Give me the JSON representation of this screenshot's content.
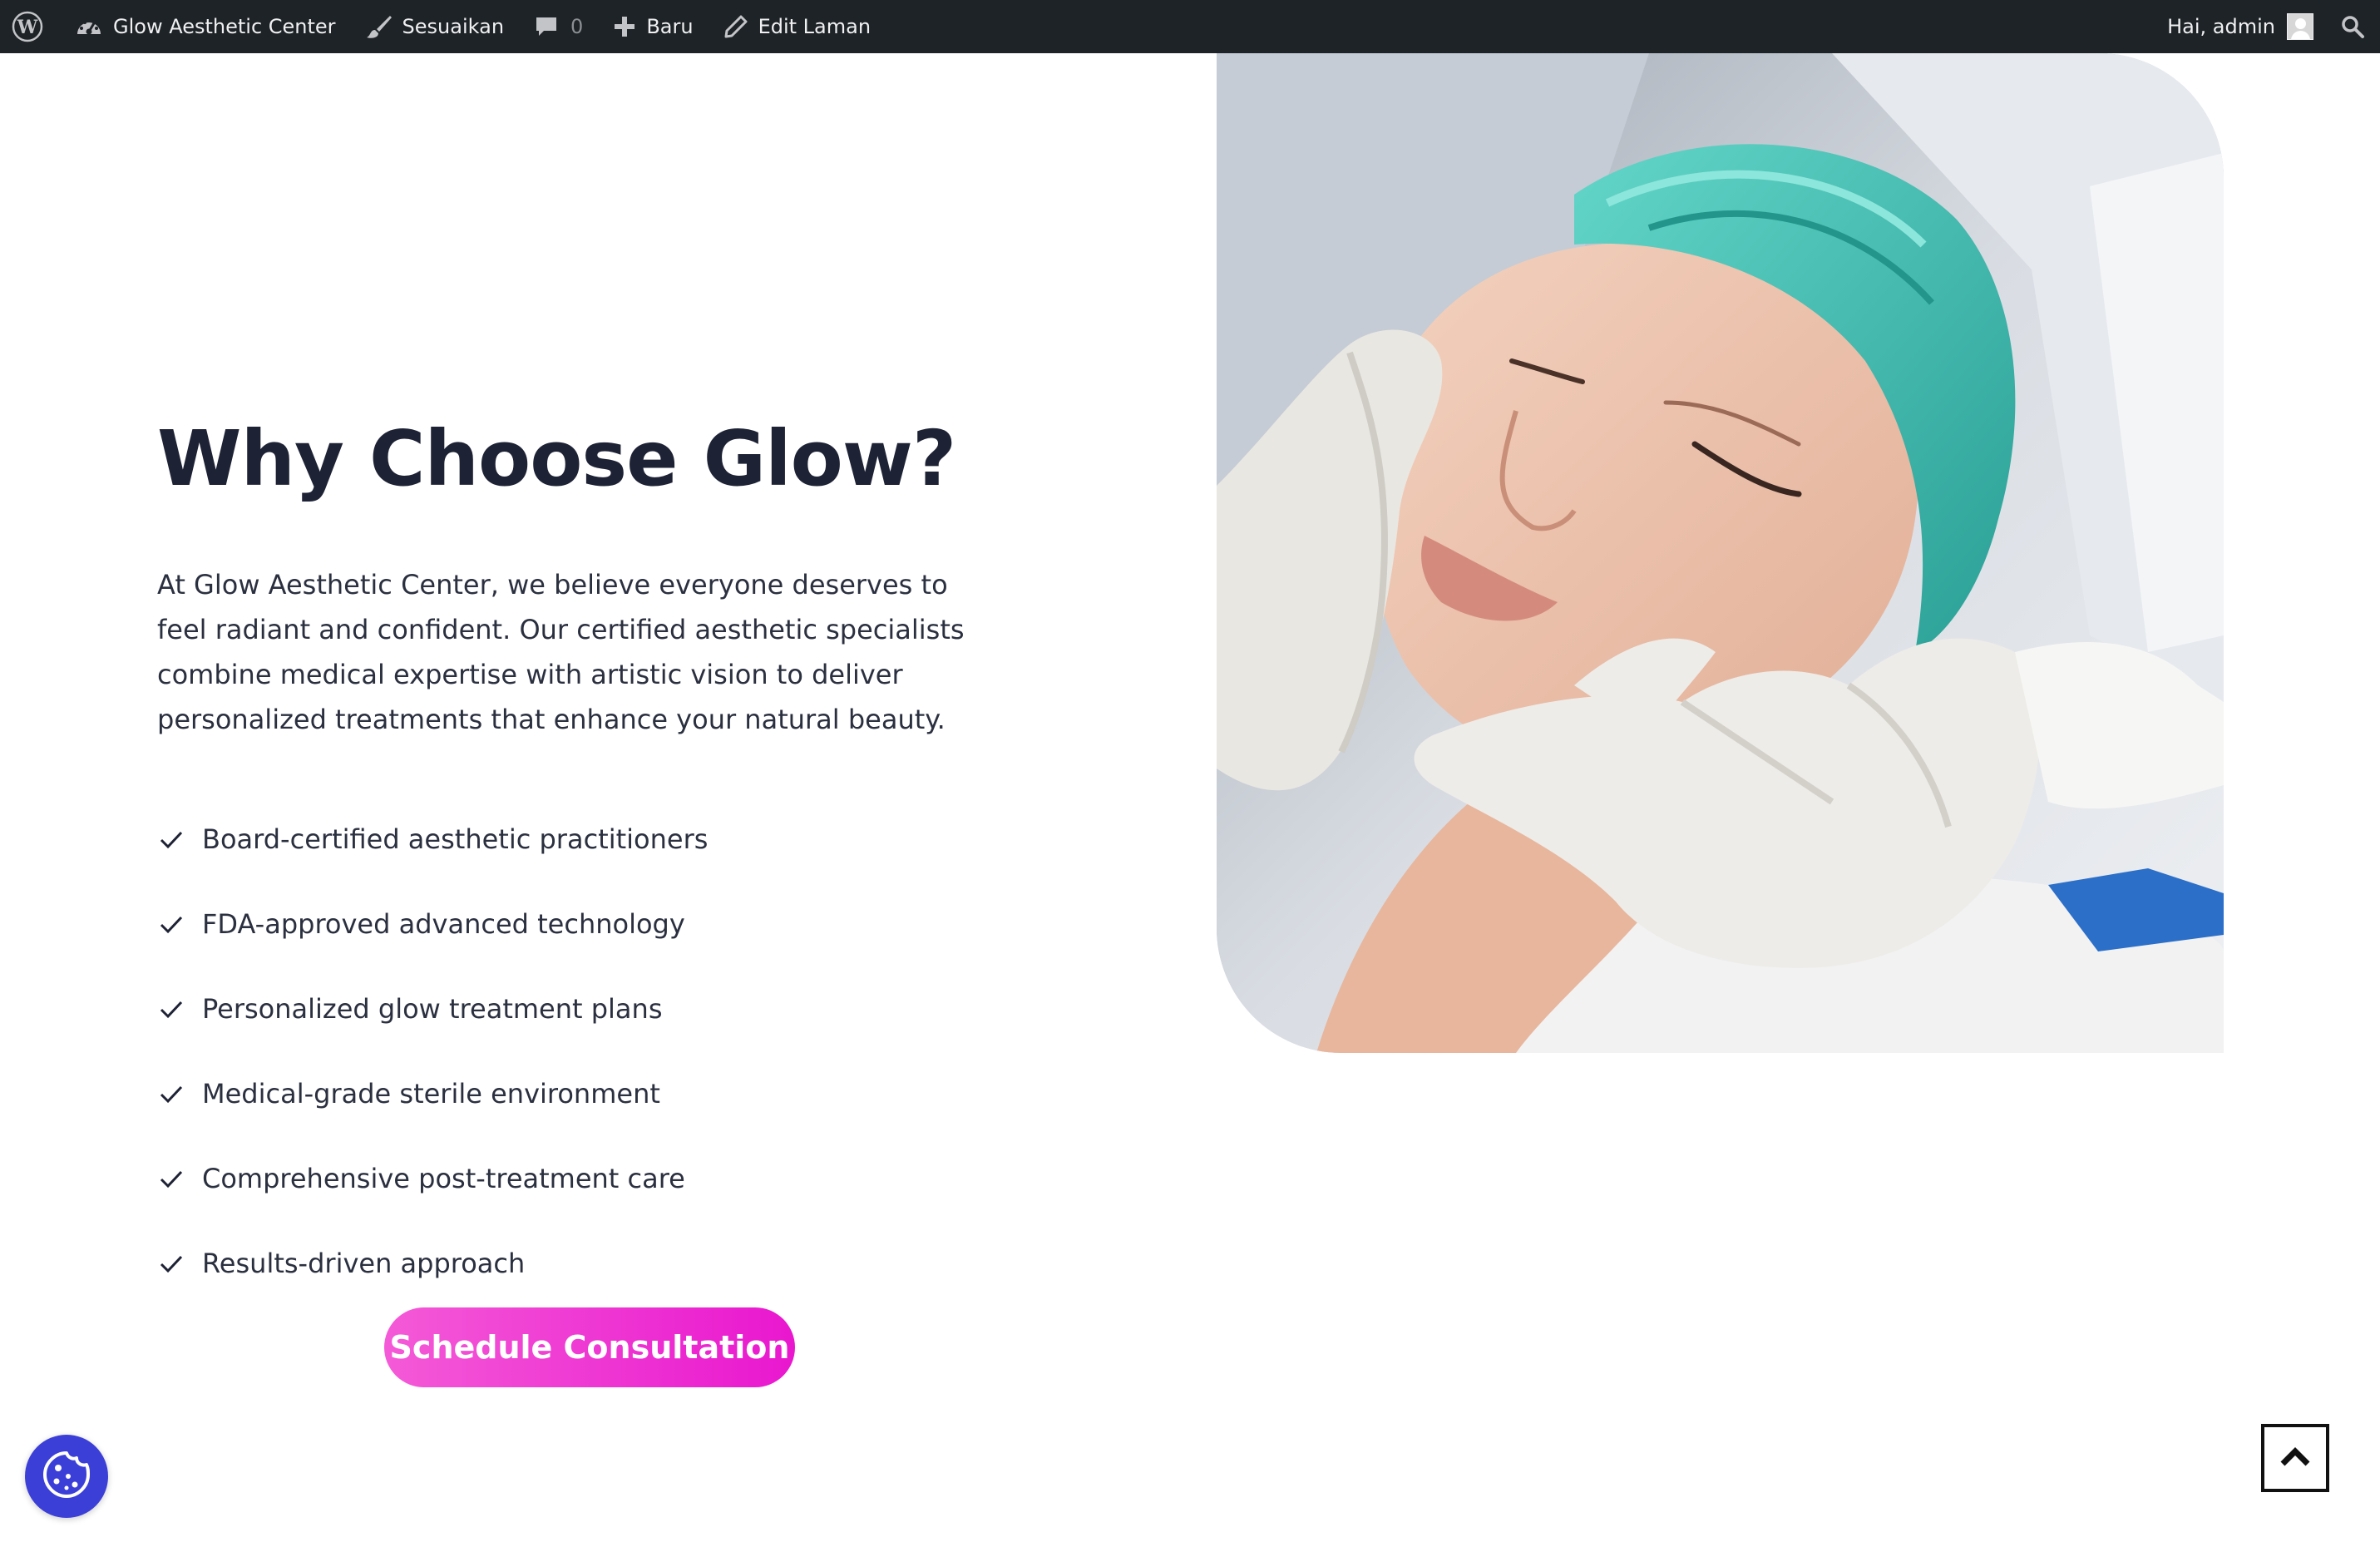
{
  "admin_bar": {
    "site_name": "Glow Aesthetic Center",
    "customize_label": "Sesuaikan",
    "comments_count": "0",
    "new_label": "Baru",
    "edit_label": "Edit Laman",
    "greeting": "Hai, admin",
    "icons": [
      "wordpress-logo-icon",
      "dashboard-icon",
      "brush-icon",
      "comment-icon",
      "plus-icon",
      "pencil-icon",
      "search-icon"
    ]
  },
  "main": {
    "heading": "Why Choose Glow?",
    "intro": "At Glow Aesthetic Center, we believe everyone deserves to feel radiant and confident. Our certified aesthetic specialists combine medical expertise with artistic vision to deliver personalized treatments that enhance your natural beauty.",
    "features": [
      "Board-certified aesthetic practitioners",
      "FDA-approved advanced technology",
      "Personalized glow treatment plans",
      "Medical-grade sterile environment",
      "Comprehensive post-treatment care",
      "Results-driven approach"
    ],
    "cta_label": "Schedule Consultation"
  },
  "colors": {
    "admin_bar_bg": "#1d2327",
    "heading": "#1d2235",
    "cta_gradient_start": "#f45ad7",
    "cta_gradient_end": "#e917cf",
    "cookie_button": "#3b3fd8"
  },
  "floating": {
    "cookie_icon": "cookie-icon",
    "scroll_top_icon": "chevron-up-icon"
  }
}
